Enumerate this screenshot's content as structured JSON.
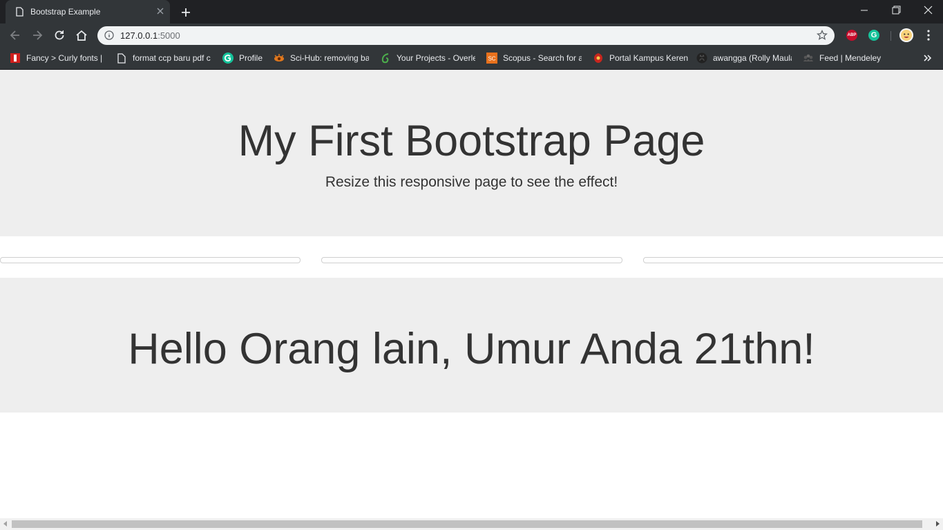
{
  "browser": {
    "tab_title": "Bootstrap Example",
    "url_host": "127.0.0.1",
    "url_port": ":5000",
    "extensions": {
      "abp_label": "ABP",
      "grammarly_label": "G"
    }
  },
  "bookmarks": [
    {
      "label": "Fancy > Curly fonts |",
      "icon": "bookmark-favicon-red"
    },
    {
      "label": "format ccp baru pdf c",
      "icon": "page-icon"
    },
    {
      "label": "Profile",
      "icon": "grammarly-icon"
    },
    {
      "label": "Sci-Hub: removing ba",
      "icon": "scihub-icon"
    },
    {
      "label": "Your Projects - Overle",
      "icon": "overleaf-icon"
    },
    {
      "label": "Scopus - Search for a",
      "icon": "scopus-icon"
    },
    {
      "label": "Portal Kampus Keren",
      "icon": "campus-icon"
    },
    {
      "label": "awangga (Rolly Maulan",
      "icon": "github-icon"
    },
    {
      "label": "Feed | Mendeley",
      "icon": "mendeley-icon"
    }
  ],
  "page": {
    "jumbotron_title": "My First Bootstrap Page",
    "jumbotron_subtitle": "Resize this responsive page to see the effect!",
    "greeting": "Hello Orang lain, Umur Anda 21thn!"
  },
  "colors": {
    "chrome_dark": "#202124",
    "chrome_toolbar": "#323639",
    "jumbotron_bg": "#eeeeee",
    "text": "#333333"
  }
}
